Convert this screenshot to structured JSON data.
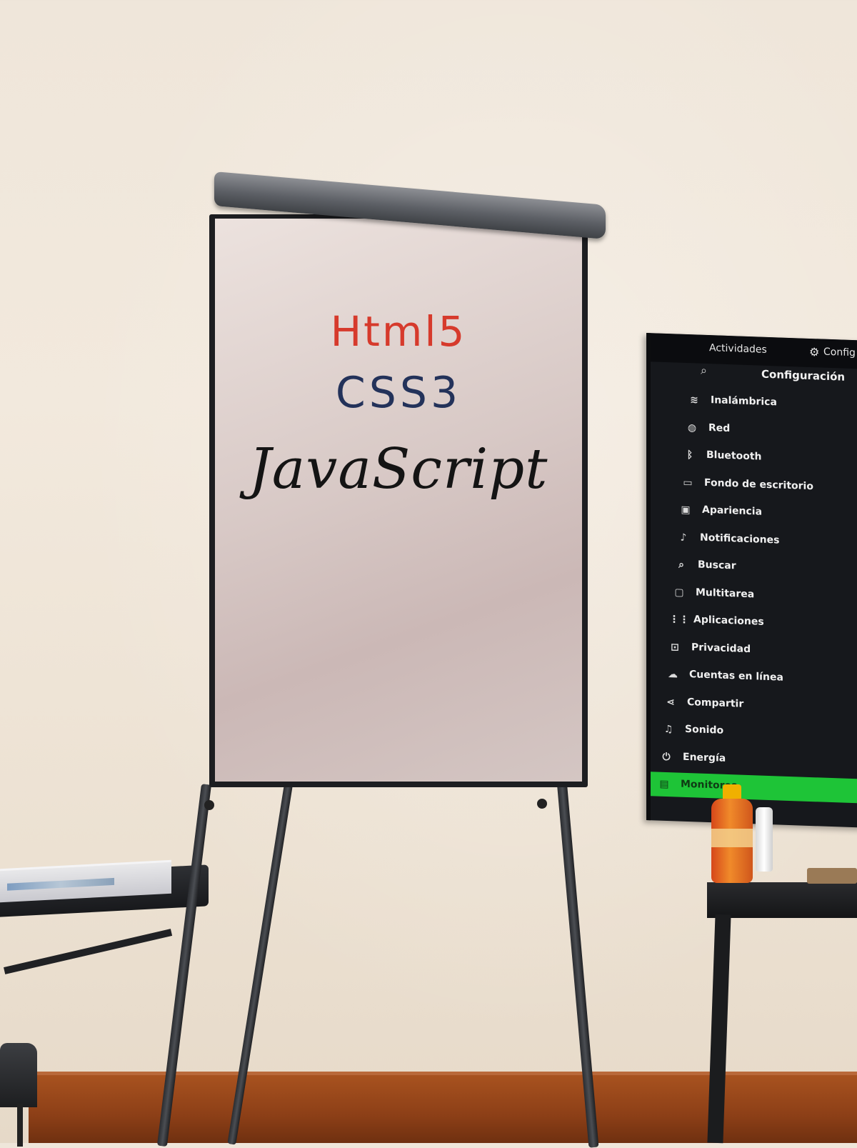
{
  "flipchart": {
    "lines": [
      "Html5",
      "CSS3",
      "JavaScript"
    ],
    "colors": [
      "#d63a2c",
      "#23325a",
      "#141414"
    ]
  },
  "monitor": {
    "topbar": {
      "activities": "Actividades",
      "settings_tab": "Config"
    },
    "header_title": "Configuración",
    "menu": [
      {
        "label": "Inalámbrica",
        "icon": "wifi-icon",
        "glyph": "≋"
      },
      {
        "label": "Red",
        "icon": "globe-icon",
        "glyph": "◍"
      },
      {
        "label": "Bluetooth",
        "icon": "bluetooth-icon",
        "glyph": "ᛒ"
      },
      {
        "label": "Fondo de escritorio",
        "icon": "wallpaper-icon",
        "glyph": "▭"
      },
      {
        "label": "Apariencia",
        "icon": "appearance-icon",
        "glyph": "▣"
      },
      {
        "label": "Notificaciones",
        "icon": "bell-icon",
        "glyph": "♪"
      },
      {
        "label": "Buscar",
        "icon": "search-icon",
        "glyph": "⌕"
      },
      {
        "label": "Multitarea",
        "icon": "multitask-icon",
        "glyph": "▢"
      },
      {
        "label": "Aplicaciones",
        "icon": "apps-grid-icon",
        "glyph": "⋮⋮"
      },
      {
        "label": "Privacidad",
        "icon": "lock-icon",
        "glyph": "⊡"
      },
      {
        "label": "Cuentas en línea",
        "icon": "cloud-icon",
        "glyph": "☁"
      },
      {
        "label": "Compartir",
        "icon": "share-icon",
        "glyph": "⋖"
      },
      {
        "label": "Sonido",
        "icon": "music-icon",
        "glyph": "♫"
      },
      {
        "label": "Energía",
        "icon": "power-icon",
        "glyph": "⏻"
      },
      {
        "label": "Monitores",
        "icon": "display-icon",
        "glyph": "▤",
        "selected": true
      }
    ],
    "accent_color": "#1ec437"
  }
}
